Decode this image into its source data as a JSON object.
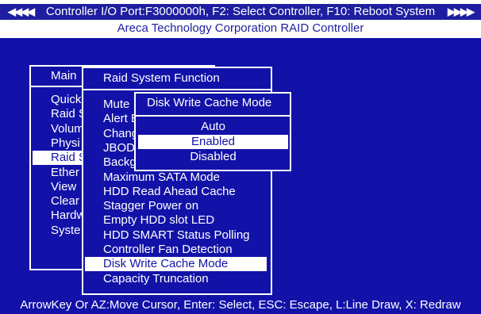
{
  "header": {
    "title": "Controller I/O Port:F3000000h, F2: Select Controller, F10: Reboot System",
    "left_arrows": "◀◀◀◀",
    "right_arrows": "▶▶▶▶",
    "subtitle": "Areca Technology Corporation RAID Controller"
  },
  "main_menu": {
    "title": "Main",
    "items": [
      "Quick",
      "Raid S",
      "Volum",
      "Physi",
      "Raid S",
      "Ether",
      "View",
      "Clear",
      "Hardw",
      "Syste"
    ],
    "selected_index": 4
  },
  "raid_function_menu": {
    "title": "Raid System Function",
    "items": [
      "Mute",
      "Alert B",
      "Chang",
      "JBOD",
      "Backg",
      "Maximum SATA Mode",
      "HDD Read Ahead Cache",
      "Stagger Power on",
      "Empty HDD slot LED",
      "HDD SMART Status Polling",
      "Controller Fan Detection",
      "Disk Write Cache Mode",
      "Capacity Truncation"
    ],
    "selected_index": 11
  },
  "cache_mode_menu": {
    "title": "Disk Write Cache Mode",
    "options": [
      "Auto",
      "Enabled",
      "Disabled"
    ],
    "selected_index": 1
  },
  "footer": {
    "help_text": "ArrowKey Or AZ:Move Cursor, Enter: Select, ESC: Escape, L:Line Draw, X: Redraw"
  },
  "colors": {
    "background": "#1212a8",
    "foreground": "#ffffff",
    "header_text": "#1e1ea0"
  }
}
